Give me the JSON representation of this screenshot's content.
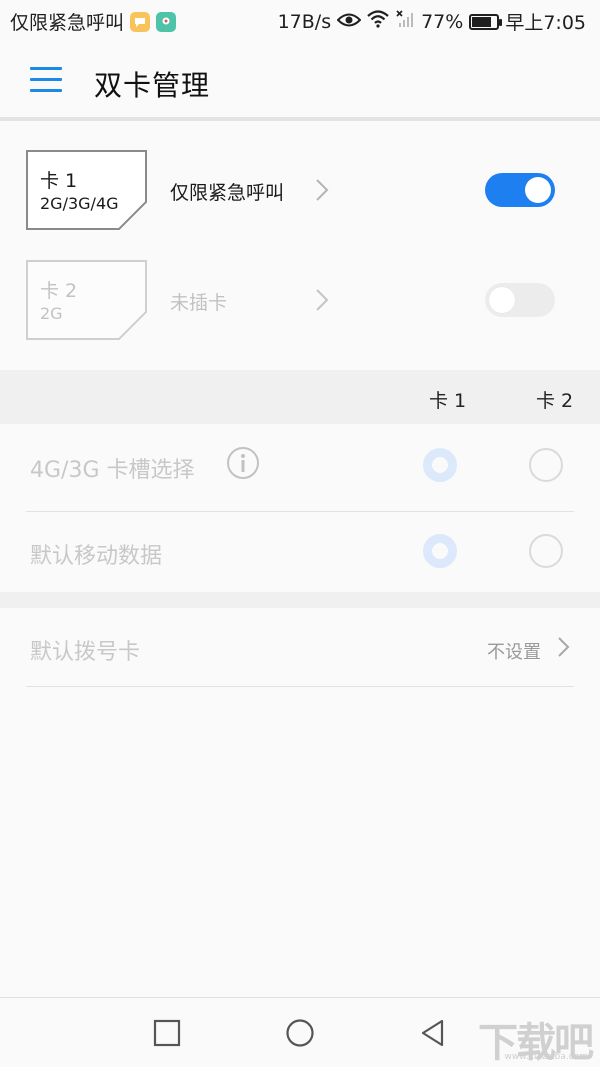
{
  "status_bar": {
    "carrier": "仅限紧急呼叫",
    "speed": "17B/s",
    "battery": "77%",
    "battery_level": 0.77,
    "time": "早上7:05"
  },
  "header": {
    "title": "双卡管理"
  },
  "sims": [
    {
      "name": "卡 1",
      "network": "2G/3G/4G",
      "status": "仅限紧急呼叫",
      "enabled": true
    },
    {
      "name": "卡 2",
      "network": "2G",
      "status": "未插卡",
      "enabled": false
    }
  ],
  "table_header": {
    "col1": "卡 1",
    "col2": "卡 2"
  },
  "options": [
    {
      "label": "4G/3G 卡槽选择",
      "selected": "卡 1"
    },
    {
      "label": "默认移动数据",
      "selected": "卡 1"
    }
  ],
  "dial": {
    "label": "默认拨号卡",
    "value": "不设置"
  },
  "watermark": {
    "text": "下载吧",
    "sub": "www.xiazaiba.com"
  },
  "colors": {
    "accent": "#1e7ff0",
    "disabled_text": "#c2c2c2"
  },
  "icons": [
    "menu-icon",
    "chevron-right-icon",
    "info-icon",
    "square-icon",
    "circle-icon",
    "back-triangle-icon",
    "wifi-icon",
    "eye-icon",
    "signal-icon",
    "battery-icon"
  ]
}
